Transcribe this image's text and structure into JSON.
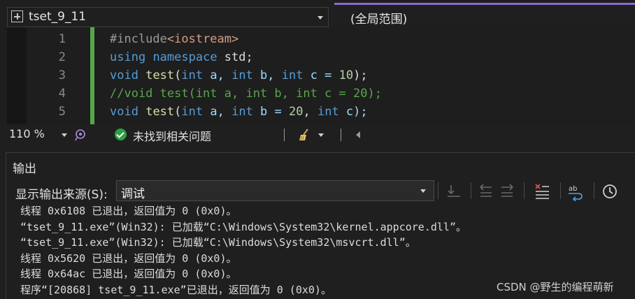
{
  "navigation": {
    "project": "tset_9_11",
    "scope": "(全局范围)"
  },
  "editor": {
    "lines": [
      {
        "num": "1",
        "tokens": [
          {
            "t": "#include",
            "c": "#9b9b9b"
          },
          {
            "t": "<iostream>",
            "c": "#d69d85"
          }
        ]
      },
      {
        "num": "2",
        "tokens": [
          {
            "t": "using",
            "c": "#569cd6"
          },
          {
            "t": " ",
            "c": "#dcdcdc"
          },
          {
            "t": "namespace",
            "c": "#569cd6"
          },
          {
            "t": " std;",
            "c": "#dcdcdc"
          }
        ]
      },
      {
        "num": "3",
        "tokens": [
          {
            "t": "void",
            "c": "#569cd6"
          },
          {
            "t": " ",
            "c": "#dcdcdc"
          },
          {
            "t": "test",
            "c": "#dcdcaa"
          },
          {
            "t": "(",
            "c": "#dcdcdc"
          },
          {
            "t": "int",
            "c": "#569cd6"
          },
          {
            "t": " a, ",
            "c": "#9cdcfe"
          },
          {
            "t": "int",
            "c": "#569cd6"
          },
          {
            "t": " b, ",
            "c": "#9cdcfe"
          },
          {
            "t": "int",
            "c": "#569cd6"
          },
          {
            "t": " c = ",
            "c": "#9cdcfe"
          },
          {
            "t": "10",
            "c": "#b5cea8"
          },
          {
            "t": ");",
            "c": "#dcdcdc"
          }
        ]
      },
      {
        "num": "4",
        "tokens": [
          {
            "t": "//void test(int a, int b, int c = 20);",
            "c": "#57a64a"
          }
        ]
      },
      {
        "num": "5",
        "tokens": [
          {
            "t": "void",
            "c": "#569cd6"
          },
          {
            "t": " ",
            "c": "#dcdcdc"
          },
          {
            "t": "test",
            "c": "#dcdcaa"
          },
          {
            "t": "(",
            "c": "#dcdcdc"
          },
          {
            "t": "int",
            "c": "#569cd6"
          },
          {
            "t": " a, ",
            "c": "#9cdcfe"
          },
          {
            "t": "int",
            "c": "#569cd6"
          },
          {
            "t": " b = ",
            "c": "#9cdcfe"
          },
          {
            "t": "20",
            "c": "#b5cea8"
          },
          {
            "t": ", ",
            "c": "#dcdcdc"
          },
          {
            "t": "int",
            "c": "#569cd6"
          },
          {
            "t": " c);",
            "c": "#9cdcfe"
          }
        ]
      }
    ]
  },
  "statusbar": {
    "zoom": "110 %",
    "issues": "未找到相关问题"
  },
  "output": {
    "title": "输出",
    "source_label": "显示输出来源(S):",
    "source_value": "调试",
    "lines": [
      "线程 0x6108 已退出，返回值为 0 (0x0)。",
      "“tset_9_11.exe”(Win32): 已加载“C:\\Windows\\System32\\kernel.appcore.dll”。",
      "“tset_9_11.exe”(Win32): 已加载“C:\\Windows\\System32\\msvcrt.dll”。",
      "线程 0x5620 已退出，返回值为 0 (0x0)。",
      "线程 0x64ac 已退出，返回值为 0 (0x0)。",
      "程序“[20868] tset_9_11.exe”已退出，返回值为 0 (0x0)。"
    ]
  },
  "watermark": "CSDN @野生的编程萌新"
}
